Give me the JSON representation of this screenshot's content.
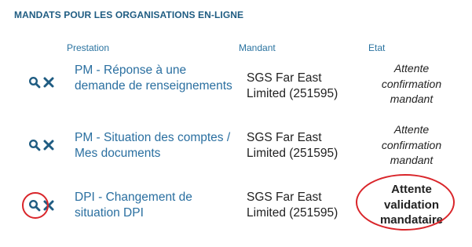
{
  "section_title": "MANDATS POUR LES ORGANISATIONS EN-LIGNE",
  "columns": {
    "prestation": "Prestation",
    "mandant": "Mandant",
    "etat": "Etat"
  },
  "rows": [
    {
      "prestation": "PM - Réponse à une demande de renseignements",
      "mandant": "SGS Far East Limited (251595)",
      "etat": "Attente confirmation mandant"
    },
    {
      "prestation": "PM - Situation des comptes / Mes documents",
      "mandant": "SGS Far East Limited (251595)",
      "etat": "Attente confirmation mandant"
    },
    {
      "prestation": "DPI - Changement de situation DPI",
      "mandant": "SGS Far East Limited (251595)",
      "etat": "Attente validation mandataire"
    }
  ],
  "icons": {
    "view": "search-icon",
    "delete": "close-icon"
  },
  "colors": {
    "accent": "#2a6fa0",
    "title": "#1f5c82",
    "highlight": "#d9252a"
  }
}
